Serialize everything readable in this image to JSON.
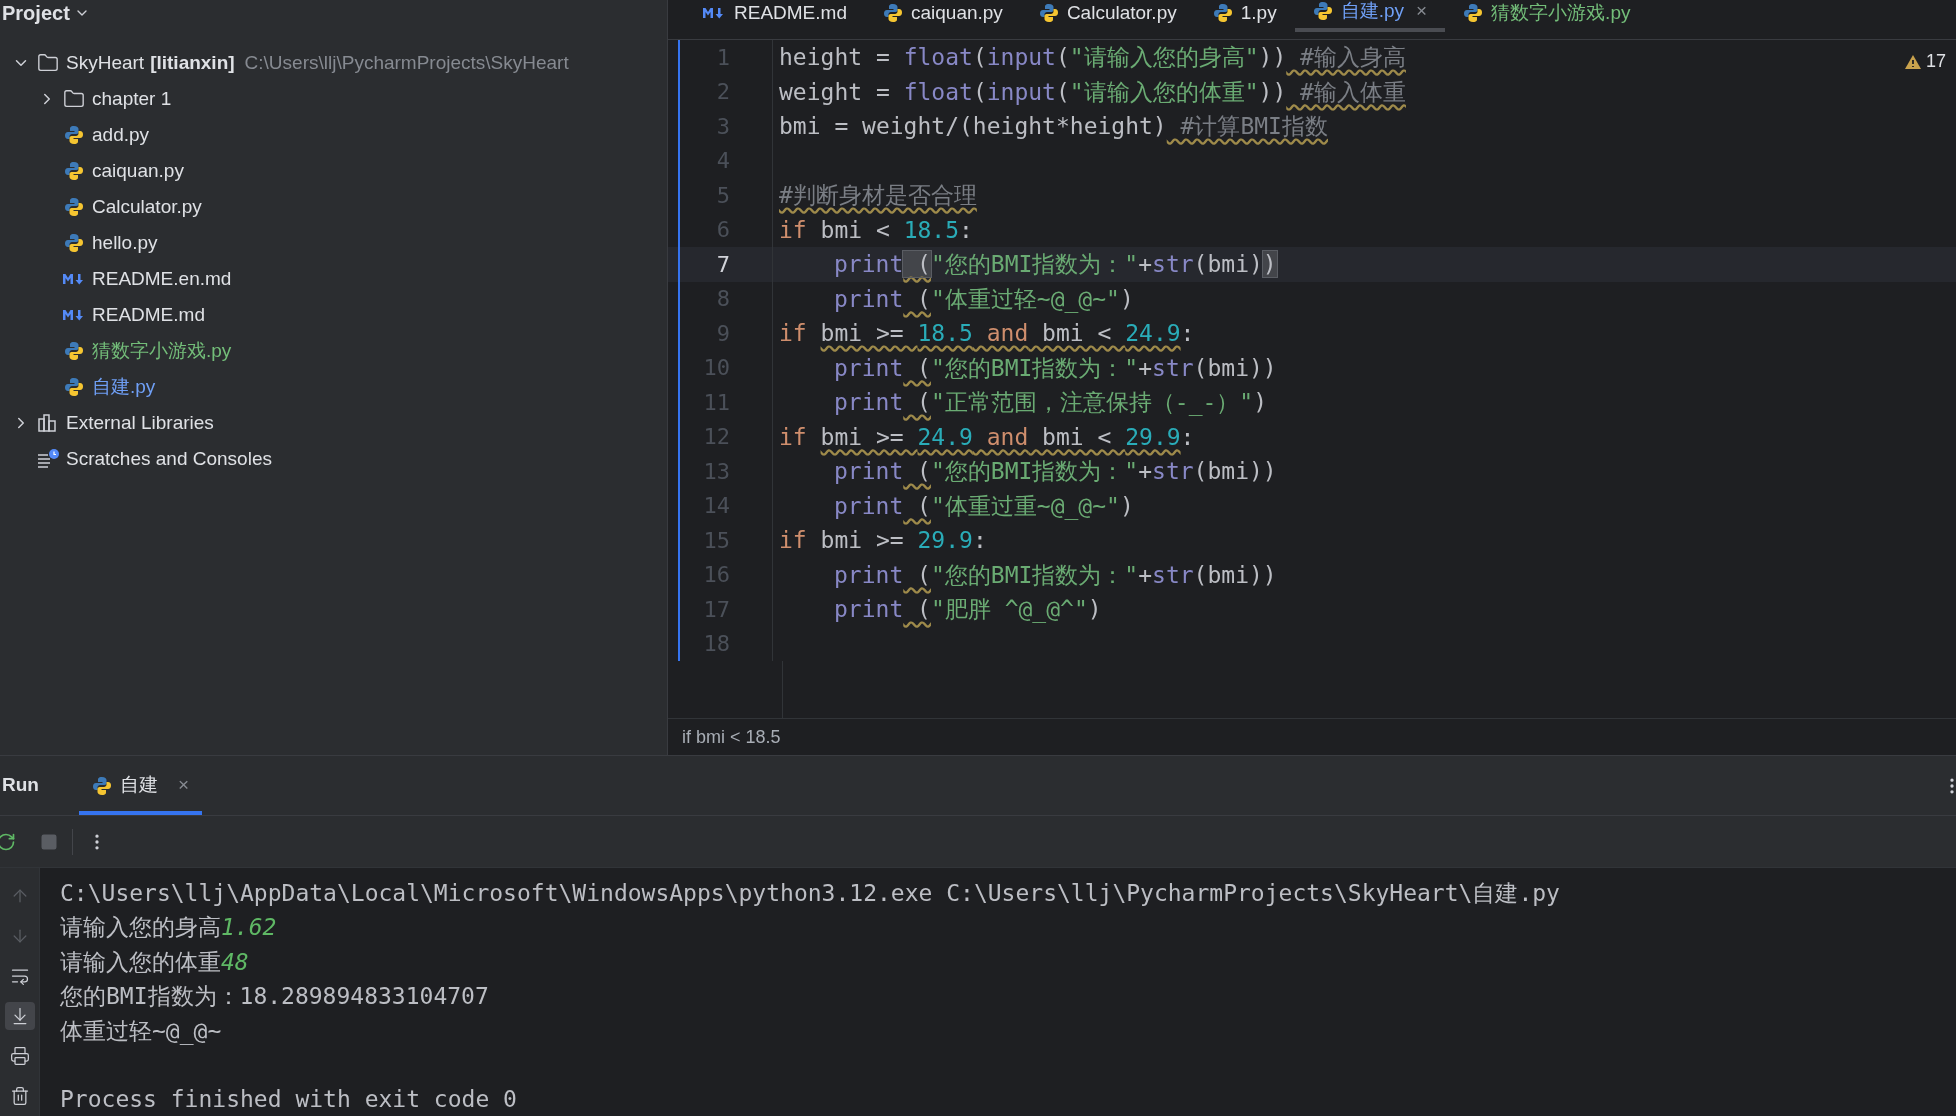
{
  "project_panel": {
    "title": "Project",
    "tree": [
      {
        "kind": "folder",
        "name": "SkyHeart",
        "module": "[litianxin]",
        "path": "C:\\Users\\llj\\PycharmProjects\\SkyHeart",
        "expanded": true,
        "color": "#dfe1e5",
        "children": [
          {
            "kind": "folder",
            "name": "chapter 1",
            "expanded": false,
            "color": "#dfe1e5"
          },
          {
            "kind": "python",
            "name": "add.py",
            "color": "#dfe1e5"
          },
          {
            "kind": "python",
            "name": "caiquan.py",
            "color": "#dfe1e5"
          },
          {
            "kind": "python",
            "name": "Calculator.py",
            "color": "#dfe1e5"
          },
          {
            "kind": "python",
            "name": "hello.py",
            "color": "#dfe1e5"
          },
          {
            "kind": "markdown",
            "name": "README.en.md",
            "color": "#dfe1e5"
          },
          {
            "kind": "markdown",
            "name": "README.md",
            "color": "#dfe1e5"
          },
          {
            "kind": "python",
            "name": "猜数字小游戏.py",
            "color": "#73bd79"
          },
          {
            "kind": "python",
            "name": "自建.py",
            "color": "#6f9ff5"
          }
        ]
      },
      {
        "kind": "library",
        "name": "External Libraries",
        "expanded": false,
        "color": "#dfe1e5"
      },
      {
        "kind": "scratches",
        "name": "Scratches and Consoles",
        "color": "#dfe1e5"
      }
    ]
  },
  "editor_tabs": [
    {
      "kind": "markdown",
      "label": "README.md",
      "selected": false,
      "color": "#dfe1e5"
    },
    {
      "kind": "python",
      "label": "caiquan.py",
      "selected": false,
      "color": "#dfe1e5"
    },
    {
      "kind": "python",
      "label": "Calculator.py",
      "selected": false,
      "color": "#dfe1e5"
    },
    {
      "kind": "python",
      "label": "1.py",
      "selected": false,
      "color": "#dfe1e5"
    },
    {
      "kind": "python",
      "label": "自建.py",
      "selected": true,
      "color": "#6f9ff5",
      "close": "×"
    },
    {
      "kind": "python",
      "label": "猜数字小游戏.py",
      "selected": false,
      "color": "#73bd79"
    }
  ],
  "warnings": {
    "count": "17"
  },
  "code": [
    {
      "number": "1",
      "indented": false,
      "current": false,
      "tokens": [
        {
          "text": "height = ",
          "kind": "plain"
        },
        {
          "text": "float",
          "kind": "builtin"
        },
        {
          "text": "(",
          "kind": "plain"
        },
        {
          "text": "input",
          "kind": "builtin"
        },
        {
          "text": "(",
          "kind": "plain"
        },
        {
          "text": "\"请输入您的身高\"",
          "kind": "string"
        },
        {
          "text": "))",
          "kind": "plain"
        },
        {
          "text": " #输入身高",
          "kind": "comment",
          "warn": true
        }
      ]
    },
    {
      "number": "2",
      "indented": false,
      "current": false,
      "tokens": [
        {
          "text": "weight = ",
          "kind": "plain"
        },
        {
          "text": "float",
          "kind": "builtin"
        },
        {
          "text": "(",
          "kind": "plain"
        },
        {
          "text": "input",
          "kind": "builtin"
        },
        {
          "text": "(",
          "kind": "plain"
        },
        {
          "text": "\"请输入您的体重\"",
          "kind": "string"
        },
        {
          "text": "))",
          "kind": "plain"
        },
        {
          "text": " #输入体重",
          "kind": "comment",
          "warn": true
        }
      ]
    },
    {
      "number": "3",
      "indented": false,
      "current": false,
      "tokens": [
        {
          "text": "bmi = weight/(height*height)",
          "kind": "plain"
        },
        {
          "text": " #计算BMI指数",
          "kind": "comment",
          "warn": true
        }
      ]
    },
    {
      "number": "4",
      "current": false
    },
    {
      "number": "5",
      "indented": false,
      "current": false,
      "tokens": [
        {
          "text": "#判断身材是否合理",
          "kind": "comment",
          "warn": true
        }
      ]
    },
    {
      "number": "6",
      "indented": false,
      "current": false,
      "tokens": [
        {
          "text": "if",
          "kind": "keyword"
        },
        {
          "text": " bmi < ",
          "kind": "plain"
        },
        {
          "text": "18.5",
          "kind": "number"
        },
        {
          "text": ":",
          "kind": "plain"
        }
      ]
    },
    {
      "number": "7",
      "indented": true,
      "current": true,
      "tokens": [
        {
          "text": "print",
          "kind": "builtin"
        },
        {
          "text": " (",
          "kind": "plain",
          "warn": true,
          "brace_match": true
        },
        {
          "text": "\"您的BMI指数为：\"",
          "kind": "string"
        },
        {
          "text": "+",
          "kind": "plain"
        },
        {
          "text": "str",
          "kind": "builtin"
        },
        {
          "text": "(bmi)",
          "kind": "plain"
        },
        {
          "text": ")",
          "kind": "plain",
          "brace_match": true
        }
      ]
    },
    {
      "number": "8",
      "indented": true,
      "current": false,
      "tokens": [
        {
          "text": "print",
          "kind": "builtin"
        },
        {
          "text": " (",
          "kind": "plain",
          "warn": true
        },
        {
          "text": "\"体重过轻~@_@~\"",
          "kind": "string"
        },
        {
          "text": ")",
          "kind": "plain"
        }
      ]
    },
    {
      "number": "9",
      "indented": false,
      "current": false,
      "tokens": [
        {
          "text": "if ",
          "kind": "keyword"
        },
        {
          "text": "bmi >= ",
          "kind": "plain",
          "warn": true
        },
        {
          "text": "18.5",
          "kind": "number",
          "warn": true
        },
        {
          "text": " and",
          "kind": "keyword",
          "warn": true
        },
        {
          "text": " bmi < ",
          "kind": "plain",
          "warn": true
        },
        {
          "text": "24.9",
          "kind": "number",
          "warn": true
        },
        {
          "text": ":",
          "kind": "plain"
        }
      ]
    },
    {
      "number": "10",
      "indented": true,
      "current": false,
      "tokens": [
        {
          "text": "print",
          "kind": "builtin"
        },
        {
          "text": " (",
          "kind": "plain",
          "warn": true
        },
        {
          "text": "\"您的BMI指数为：\"",
          "kind": "string"
        },
        {
          "text": "+",
          "kind": "plain"
        },
        {
          "text": "str",
          "kind": "builtin"
        },
        {
          "text": "(bmi))",
          "kind": "plain"
        }
      ]
    },
    {
      "number": "11",
      "indented": true,
      "current": false,
      "tokens": [
        {
          "text": "print",
          "kind": "builtin"
        },
        {
          "text": " (",
          "kind": "plain",
          "warn": true
        },
        {
          "text": "\"正常范围，注意保持（-_-）\"",
          "kind": "string"
        },
        {
          "text": ")",
          "kind": "plain"
        }
      ]
    },
    {
      "number": "12",
      "indented": false,
      "current": false,
      "tokens": [
        {
          "text": "if ",
          "kind": "keyword"
        },
        {
          "text": "bmi >= ",
          "kind": "plain",
          "warn": true
        },
        {
          "text": "24.9",
          "kind": "number",
          "warn": true
        },
        {
          "text": " and",
          "kind": "keyword",
          "warn": true
        },
        {
          "text": " bmi < ",
          "kind": "plain",
          "warn": true
        },
        {
          "text": "29.9",
          "kind": "number",
          "warn": true
        },
        {
          "text": ":",
          "kind": "plain"
        }
      ]
    },
    {
      "number": "13",
      "indented": true,
      "current": false,
      "tokens": [
        {
          "text": "print",
          "kind": "builtin"
        },
        {
          "text": " (",
          "kind": "plain",
          "warn": true
        },
        {
          "text": "\"您的BMI指数为：\"",
          "kind": "string"
        },
        {
          "text": "+",
          "kind": "plain"
        },
        {
          "text": "str",
          "kind": "builtin"
        },
        {
          "text": "(bmi))",
          "kind": "plain"
        }
      ]
    },
    {
      "number": "14",
      "indented": true,
      "current": false,
      "tokens": [
        {
          "text": "print",
          "kind": "builtin"
        },
        {
          "text": " (",
          "kind": "plain",
          "warn": true
        },
        {
          "text": "\"体重过重~@_@~\"",
          "kind": "string"
        },
        {
          "text": ")",
          "kind": "plain"
        }
      ]
    },
    {
      "number": "15",
      "indented": false,
      "current": false,
      "tokens": [
        {
          "text": "if",
          "kind": "keyword"
        },
        {
          "text": " bmi >= ",
          "kind": "plain"
        },
        {
          "text": "29.9",
          "kind": "number"
        },
        {
          "text": ":",
          "kind": "plain"
        }
      ]
    },
    {
      "number": "16",
      "indented": true,
      "current": false,
      "tokens": [
        {
          "text": "print",
          "kind": "builtin"
        },
        {
          "text": " (",
          "kind": "plain",
          "warn": true
        },
        {
          "text": "\"您的BMI指数为：\"",
          "kind": "string"
        },
        {
          "text": "+",
          "kind": "plain"
        },
        {
          "text": "str",
          "kind": "builtin"
        },
        {
          "text": "(bmi))",
          "kind": "plain"
        }
      ]
    },
    {
      "number": "17",
      "indented": true,
      "current": false,
      "tokens": [
        {
          "text": "print",
          "kind": "builtin"
        },
        {
          "text": " (",
          "kind": "plain",
          "warn": true
        },
        {
          "text": "\"肥胖 ^@_@^\"",
          "kind": "string"
        },
        {
          "text": ")",
          "kind": "plain"
        }
      ]
    },
    {
      "number": "18",
      "current": false
    }
  ],
  "breadcrumb": "if bmi < 18.5",
  "run_panel": {
    "title": "Run",
    "tabs": [
      {
        "label": "自建",
        "selected": true,
        "close": "×"
      }
    ],
    "side_tools": [
      {
        "kind": "up",
        "selected": false
      },
      {
        "kind": "down",
        "selected": false
      },
      {
        "kind": "wrap",
        "selected": false
      },
      {
        "kind": "scroll_end",
        "selected": true
      },
      {
        "kind": "print",
        "selected": false
      },
      {
        "kind": "trash",
        "selected": false
      }
    ],
    "console": [
      {
        "kind": "output",
        "segments": [
          {
            "text": "C:\\Users\\llj\\AppData\\Local\\Microsoft\\WindowsApps\\python3.12.exe C:\\Users\\llj\\PycharmProjects\\SkyHeart\\自建.py",
            "kind": "output"
          }
        ]
      },
      {
        "kind": "output",
        "segments": [
          {
            "text": "请输入您的身高",
            "kind": "output"
          },
          {
            "text": "1.62",
            "kind": "input"
          }
        ]
      },
      {
        "kind": "output",
        "segments": [
          {
            "text": "请输入您的体重",
            "kind": "output"
          },
          {
            "text": "48",
            "kind": "input"
          }
        ]
      },
      {
        "kind": "output",
        "segments": [
          {
            "text": "您的BMI指数为：18.289894833104707",
            "kind": "output"
          }
        ]
      },
      {
        "kind": "output",
        "segments": [
          {
            "text": "体重过轻~@_@~",
            "kind": "output"
          }
        ]
      },
      {
        "kind": "status",
        "segments": [
          {
            "text": "Process finished with exit code 0",
            "kind": "output"
          }
        ]
      }
    ]
  }
}
